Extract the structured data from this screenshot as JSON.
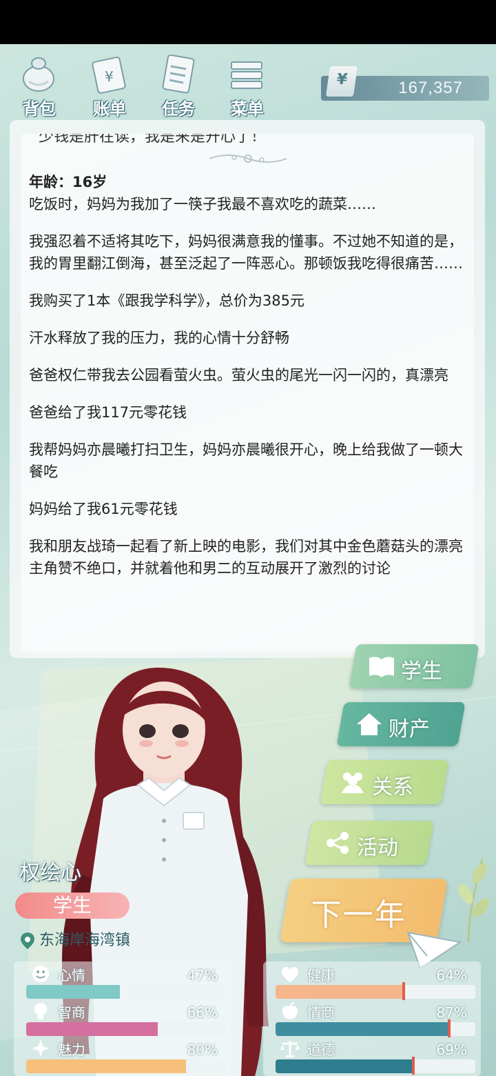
{
  "toolbar": {
    "items": [
      {
        "label": "背包",
        "icon": "bag-icon"
      },
      {
        "label": "账单",
        "icon": "bill-icon"
      },
      {
        "label": "任务",
        "icon": "task-icon"
      },
      {
        "label": "菜单",
        "icon": "menu-icon"
      }
    ]
  },
  "money": {
    "currency_symbol": "¥",
    "value": "167,357"
  },
  "log": {
    "cut_text": "少钱是肝在读，我是来是开心了！",
    "age_label": "年龄：16岁",
    "entries": [
      "吃饭时，妈妈为我加了一筷子我最不喜欢吃的蔬菜……",
      "我强忍着不适将其吃下，妈妈很满意我的懂事。不过她不知道的是，我的胃里翻江倒海，甚至泛起了一阵恶心。那顿饭我吃得很痛苦……",
      "我购买了1本《跟我学科学》，总价为385元",
      "汗水释放了我的压力，我的心情十分舒畅",
      "爸爸权仁带我去公园看萤火虫。萤火虫的尾光一闪一闪的，真漂亮",
      "爸爸给了我117元零花钱",
      "我帮妈妈亦晨曦打扫卫生，妈妈亦晨曦很开心，晚上给我做了一顿大餐吃",
      "妈妈给了我61元零花钱",
      "我和朋友战琦一起看了新上映的电影，我们对其中金色蘑菇头的漂亮主角赞不绝口，并就着他和男二的互动展开了激烈的讨论"
    ]
  },
  "side_menu": {
    "student": "学生",
    "asset": "财产",
    "relation": "关系",
    "activity": "活动"
  },
  "next_year": "下一年",
  "character": {
    "name": "权绘心",
    "role": "学生",
    "location": "东海岸海湾镇"
  },
  "stats_left": [
    {
      "name": "心情",
      "value": "47%",
      "level": 0.47,
      "color": "#7fc9c6",
      "icon": "smile-icon"
    },
    {
      "name": "智商",
      "value": "66%",
      "level": 0.66,
      "color": "#d56fa0",
      "icon": "bulb-icon"
    },
    {
      "name": "魅力",
      "value": "80%",
      "level": 0.8,
      "color": "#f6c07c",
      "icon": "sparkle-icon"
    }
  ],
  "stats_right": [
    {
      "name": "健康",
      "value": "64%",
      "level": 0.64,
      "color": "#f6b58a",
      "icon": "heart-icon"
    },
    {
      "name": "情商",
      "value": "87%",
      "level": 0.87,
      "color": "#3f8ea0",
      "icon": "apple-icon"
    },
    {
      "name": "道德",
      "value": "69%",
      "level": 0.69,
      "color": "#2e7d8f",
      "icon": "scale-icon"
    }
  ]
}
